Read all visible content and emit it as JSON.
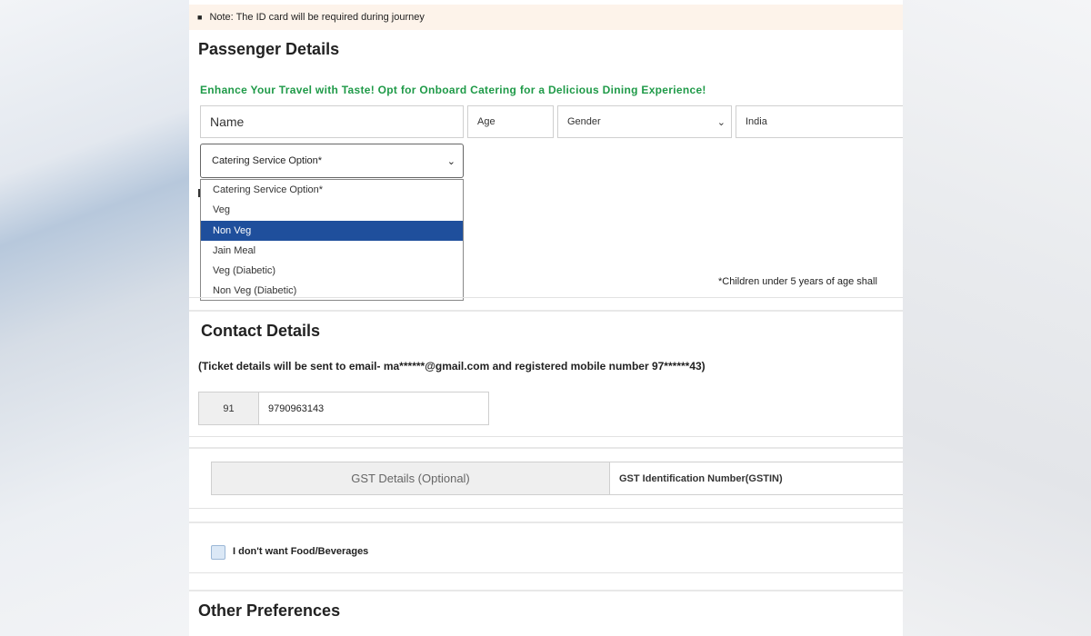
{
  "note": {
    "text": "Note: The ID card will be required during journey"
  },
  "passenger": {
    "title": "Passenger Details",
    "promo": "Enhance Your Travel with Taste! Opt for Onboard Catering for a Delicious Dining Experience!",
    "name_placeholder": "Name",
    "age_placeholder": "Age",
    "gender_value": "Gender",
    "country_value": "India",
    "catering_value": "Catering Service Option*",
    "catering_options": [
      "Catering Service Option*",
      "Veg",
      "Non Veg",
      "Jain Meal",
      "Veg (Diabetic)",
      "Non Veg (Diabetic)"
    ],
    "catering_highlighted": "Non Veg",
    "children_note": "*Children under 5 years of age shall"
  },
  "contact": {
    "title": "Contact Details",
    "info": "(Ticket details will be sent to email- ma******@gmail.com and registered mobile number 97******43)",
    "country_code": "91",
    "mobile": "9790963143"
  },
  "gst": {
    "label": "GST Details (Optional)",
    "gstin_placeholder": "GST Identification Number(GSTIN)"
  },
  "food": {
    "no_food_label": "I don't want Food/Beverages",
    "checked": false
  },
  "other": {
    "title": "Other Preferences"
  },
  "colors": {
    "promo_green": "#1f9a48",
    "selected_blue": "#1f4f9c",
    "note_bg": "#fdf3ea"
  }
}
